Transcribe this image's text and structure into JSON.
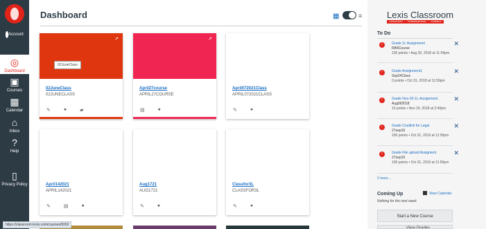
{
  "nav": {
    "logo_icon": "lexis-logo-icon",
    "account": {
      "label": "Account",
      "icon": "account-icon"
    },
    "dashboard": {
      "label": "Dashboard",
      "icon": "dashboard-icon"
    },
    "courses": {
      "label": "Courses",
      "icon": "courses-icon"
    },
    "calendar": {
      "label": "Calendar",
      "icon": "calendar-icon"
    },
    "inbox": {
      "label": "Inbox",
      "icon": "inbox-icon"
    },
    "help": {
      "label": "Help",
      "icon": "help-icon"
    },
    "privacy": {
      "label": "Privacy Policy",
      "icon": "privacy-icon"
    }
  },
  "header": {
    "title": "Dashboard",
    "view_grid_icon": "grid-view-icon",
    "view_list_icon": "list-view-icon"
  },
  "cards": [
    {
      "name": "02JuneClass",
      "code": "02JUNECLASS",
      "color": "#e0360f",
      "actions": [
        "announcement-icon",
        "discussion-icon",
        "files-icon"
      ]
    },
    {
      "name": "April27course",
      "code": "APRIL27COURSE",
      "color": "#344432",
      "actions": [
        "assignments-icon",
        "discussion-icon"
      ]
    },
    {
      "name": "April072021Class",
      "code": "APRIL072021CLASS",
      "color": "#9b2ea4",
      "actions": [
        "announcement-icon",
        "discussion-icon"
      ]
    },
    {
      "name": "April142021",
      "code": "APRIL142021",
      "color": "#1f3d7a",
      "actions": [
        "announcement-icon",
        "assignments-icon",
        "discussion-icon"
      ]
    },
    {
      "name": "Aug1721",
      "code": "AUG1721",
      "color": "#f02552",
      "actions": [
        "announcement-icon",
        "discussion-icon"
      ]
    },
    {
      "name": "Classfor3L",
      "code": "CLASSFOR3L",
      "color": "#5c6470",
      "actions": [
        "announcement-icon",
        "discussion-icon"
      ]
    }
  ],
  "tooltip": "02JuneClass",
  "brand": {
    "name": "Lexis Classroom",
    "tag_1": "CONSISTENT",
    "tag_2": "COMPREHENSIVE",
    "tag_3": "CONNECT"
  },
  "todo": {
    "title": "To Do",
    "items": [
      {
        "name": "Grade 1L Assignment",
        "course": "RB4Course",
        "meta": "100 points • Aug 30, 2018 at 11:59pm"
      },
      {
        "name": "Grade Assignment1",
        "course": "Sep24Class",
        "meta": "0 points • Oct 31, 2018 at 11:59pm"
      },
      {
        "name": "Grade Nov-20-1L-Assignment",
        "course": "Aug092018",
        "meta": "10 points • Nov 20, 2018 at 2:40pm"
      },
      {
        "name": "Grade Coutlink for Legal",
        "course": "27sep19",
        "meta": "100 points • Oct 31, 2019 at 11:59pm"
      },
      {
        "name": "Grade File upload Assigment",
        "course": "27sep19",
        "meta": "100 points • Oct 31, 2019 at 11:59pm"
      }
    ],
    "more": "2 more..."
  },
  "coming_up": {
    "title": "Coming Up",
    "calendar_link": "View Calendar",
    "note": "Nothing for the next week"
  },
  "buttons": {
    "start_course": "Start a New Course",
    "view_grades": "View Grades"
  },
  "status_url": "https://classroom.lexis.com/courses/5002"
}
